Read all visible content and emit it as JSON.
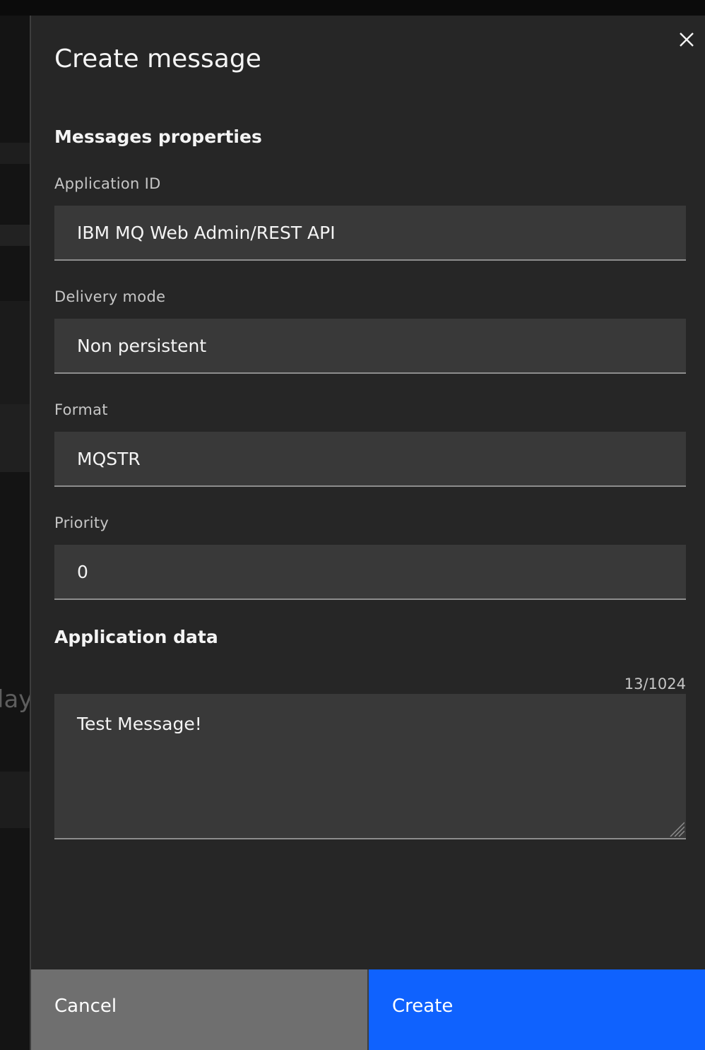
{
  "dialog": {
    "title": "Create message",
    "close_icon": "close-icon"
  },
  "backdrop": {
    "fragment_text": "lay"
  },
  "message_properties": {
    "heading": "Messages properties",
    "fields": [
      {
        "label": "Application ID",
        "value": "IBM MQ Web Admin/REST API"
      },
      {
        "label": "Delivery mode",
        "value": "Non persistent"
      },
      {
        "label": "Format",
        "value": "MQSTR"
      },
      {
        "label": "Priority",
        "value": "0"
      }
    ]
  },
  "application_data": {
    "heading": "Application data",
    "counter": "13/1024",
    "value": "Test Message!"
  },
  "footer": {
    "cancel_label": "Cancel",
    "create_label": "Create"
  },
  "colors": {
    "panel_bg": "#262626",
    "field_bg": "#393939",
    "primary": "#0f62fe",
    "secondary": "#6f6f6f"
  }
}
